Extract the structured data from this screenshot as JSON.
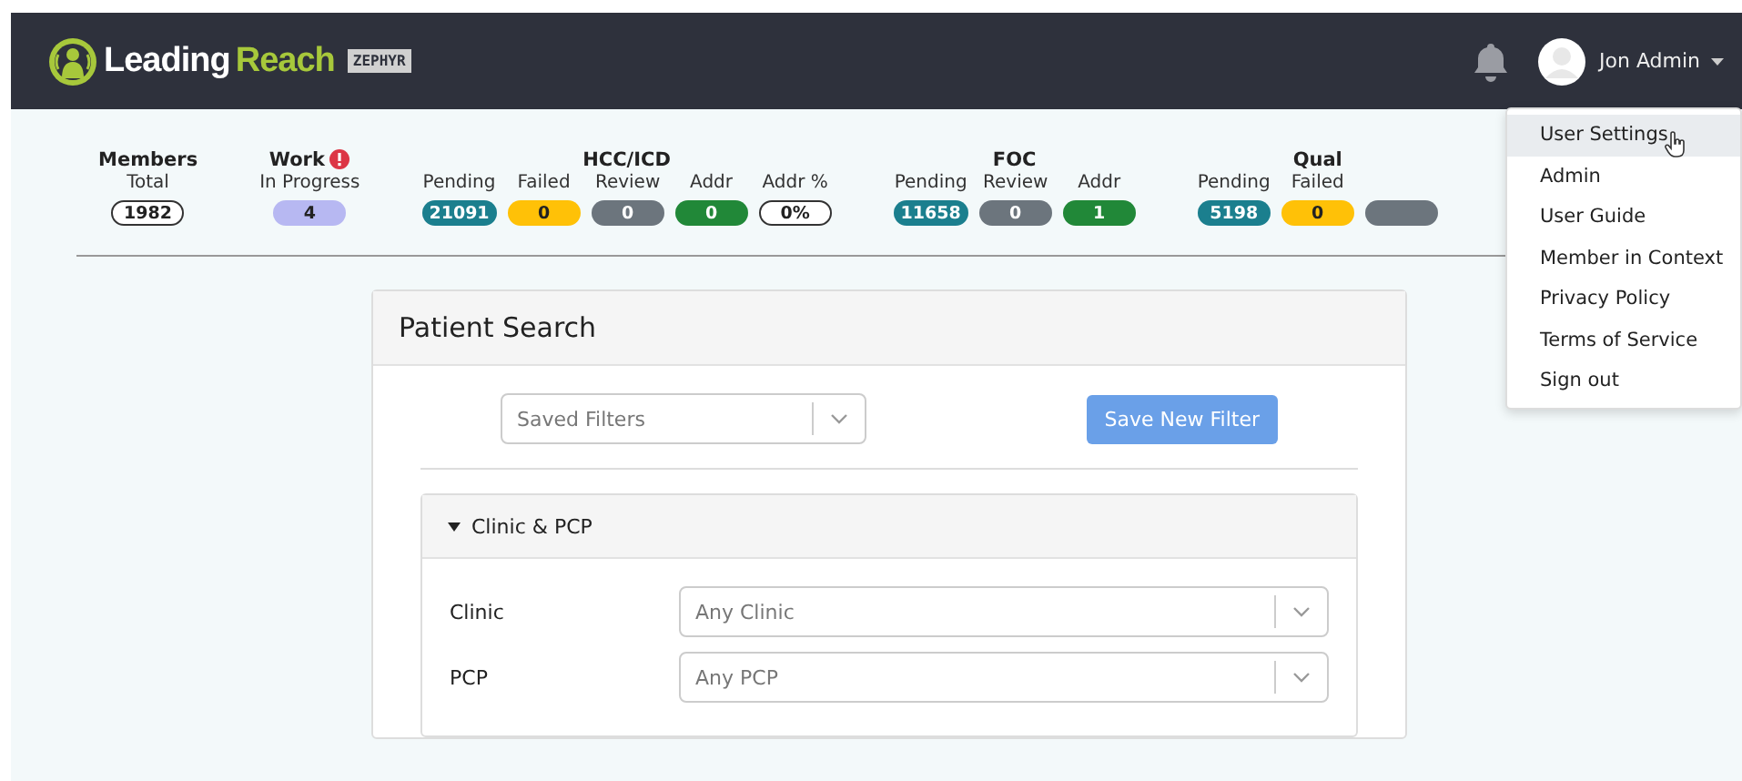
{
  "header": {
    "logo": {
      "part_1": "Leading",
      "part_2": "Reach",
      "badge": "ZEPHYR"
    },
    "user": {
      "name": "Jon Admin"
    }
  },
  "stats": [
    {
      "title": "Members",
      "alert": false,
      "items": [
        {
          "label": "Total",
          "value": "1982",
          "kind": "outline"
        }
      ]
    },
    {
      "title": "Work",
      "alert": true,
      "items": [
        {
          "label": "In Progress",
          "value": "4",
          "kind": "filled",
          "color": "#b7b8f2"
        }
      ]
    },
    {
      "title": "HCC/ICD",
      "alert": false,
      "items": [
        {
          "label": "Pending",
          "value": "21091",
          "kind": "filled",
          "color": "#1b7f8e"
        },
        {
          "label": "Failed",
          "value": "0",
          "kind": "filled",
          "color": "#ffc107"
        },
        {
          "label": "Review",
          "value": "0",
          "kind": "filled",
          "color": "#6c757d"
        },
        {
          "label": "Addr",
          "value": "0",
          "kind": "filled",
          "color": "#218838"
        },
        {
          "label": "Addr %",
          "value": "0%",
          "kind": "outline"
        }
      ]
    },
    {
      "title": "FOC",
      "alert": false,
      "items": [
        {
          "label": "Pending",
          "value": "11658",
          "kind": "filled",
          "color": "#1b7f8e"
        },
        {
          "label": "Review",
          "value": "0",
          "kind": "filled",
          "color": "#6c757d"
        },
        {
          "label": "Addr",
          "value": "1",
          "kind": "filled",
          "color": "#218838"
        }
      ]
    },
    {
      "title": "Qual",
      "alert": false,
      "items": [
        {
          "label": "Pending",
          "value": "5198",
          "kind": "filled",
          "color": "#1b7f8e"
        },
        {
          "label": "Failed",
          "value": "0",
          "kind": "filled",
          "color": "#ffc107"
        },
        {
          "kind": "filled",
          "color": "#6c757d"
        }
      ]
    }
  ],
  "user_menu": {
    "items": [
      {
        "label": "User Settings",
        "selected": true
      },
      {
        "label": "Admin",
        "selected": false
      },
      {
        "label": "User Guide",
        "selected": false
      },
      {
        "label": "Member in Context",
        "selected": false
      },
      {
        "label": "Privacy Policy",
        "selected": false
      },
      {
        "label": "Terms of Service",
        "selected": false
      },
      {
        "label": "Sign out",
        "selected": false
      }
    ]
  },
  "patient_search": {
    "title": "Patient Search",
    "saved_filters": {
      "placeholder": "Saved Filters"
    },
    "save_button": "Save New Filter",
    "section": {
      "title": "Clinic & PCP",
      "expanded": true,
      "fields": [
        {
          "label": "Clinic",
          "placeholder": "Any Clinic"
        },
        {
          "label": "PCP",
          "placeholder": "Any PCP"
        }
      ]
    }
  }
}
